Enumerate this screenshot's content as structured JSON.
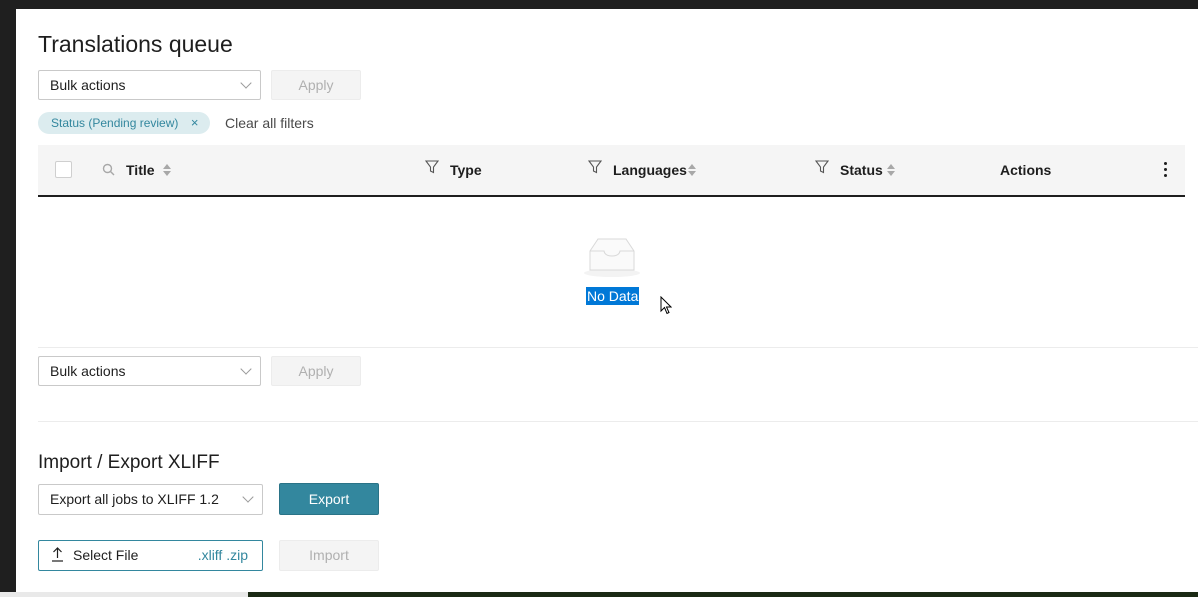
{
  "page": {
    "title": "Translations queue"
  },
  "bulk_top": {
    "select_value": "Bulk actions",
    "apply_label": "Apply"
  },
  "filters": {
    "chip_label": "Status (Pending review)",
    "chip_remove": "×",
    "clear_all": "Clear all filters"
  },
  "table": {
    "columns": [
      "Title",
      "Type",
      "Languages",
      "Status",
      "Actions"
    ],
    "empty_text": "No Data"
  },
  "bulk_bottom": {
    "select_value": "Bulk actions",
    "apply_label": "Apply"
  },
  "xliff": {
    "section_title": "Import / Export XLIFF",
    "export_select_value": "Export all jobs to XLIFF 1.2",
    "export_label": "Export",
    "select_file_label": "Select File",
    "file_ext": ".xliff .zip",
    "import_label": "Import"
  },
  "colors": {
    "accent": "#33879e",
    "selection": "#0078d7"
  }
}
